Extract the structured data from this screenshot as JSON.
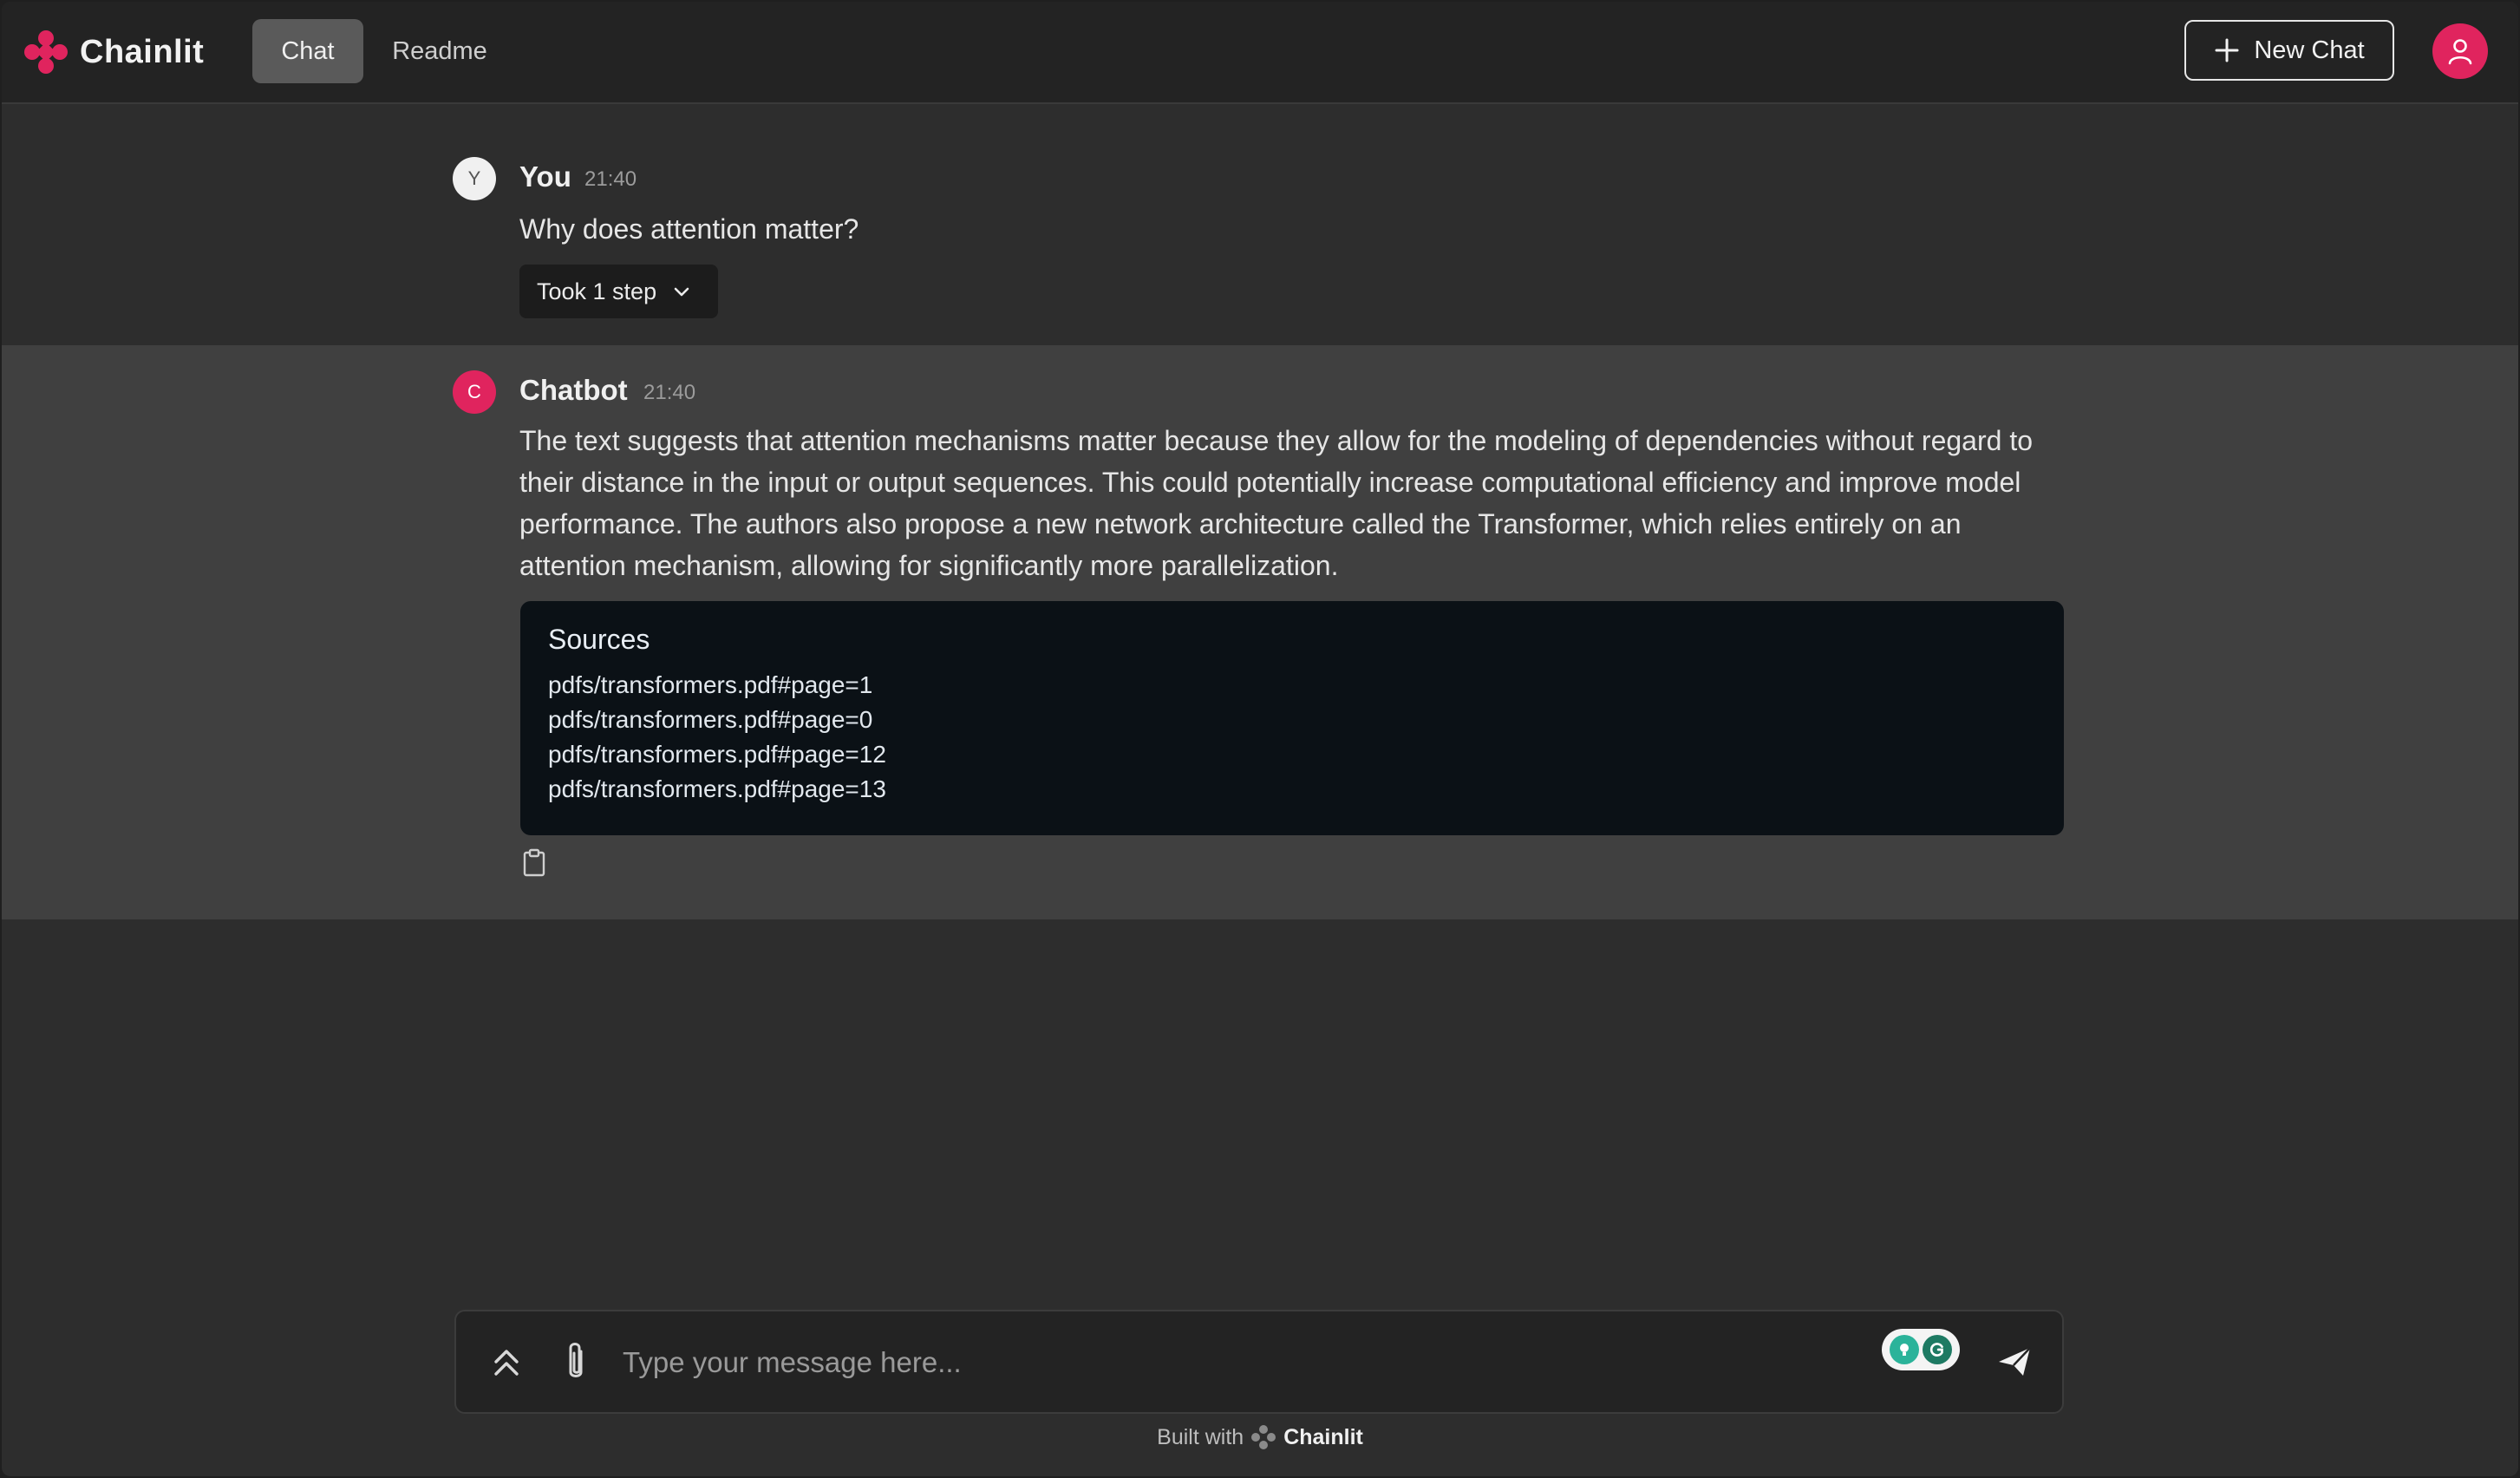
{
  "header": {
    "app_name": "Chainlit",
    "tabs": [
      {
        "label": "Chat",
        "active": true
      },
      {
        "label": "Readme",
        "active": false
      }
    ],
    "new_chat_label": "New Chat",
    "brand_color": "#e0245e"
  },
  "messages": [
    {
      "author": "You",
      "avatar_letter": "Y",
      "time": "21:40",
      "text": "Why does attention matter?",
      "step_label": "Took 1 step"
    },
    {
      "author": "Chatbot",
      "avatar_letter": "C",
      "time": "21:40",
      "text": "The text suggests that attention mechanisms matter because they allow for the modeling of dependencies without regard to their distance in the input or output sequences. This could potentially increase computational efficiency and improve model performance. The authors also propose a new network architecture called the Transformer, which relies entirely on an attention mechanism, allowing for significantly more parallelization.",
      "sources_title": "Sources",
      "sources": [
        "pdfs/transformers.pdf#page=1",
        "pdfs/transformers.pdf#page=0",
        "pdfs/transformers.pdf#page=12",
        "pdfs/transformers.pdf#page=13"
      ]
    }
  ],
  "composer": {
    "placeholder": "Type your message here..."
  },
  "footer": {
    "built_with": "Built with",
    "brand": "Chainlit"
  }
}
